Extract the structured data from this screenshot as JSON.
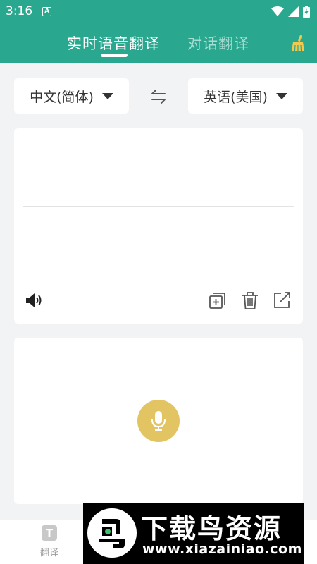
{
  "status_bar": {
    "time": "3:16",
    "notification_badge": "A"
  },
  "header": {
    "tabs": [
      {
        "label": "实时语音翻译",
        "active": true
      },
      {
        "label": "对话翻译",
        "active": false
      }
    ],
    "clear_icon": "broom-icon",
    "accent_color": "#2aa88f",
    "clear_icon_color": "#f2c94c"
  },
  "languages": {
    "source": "中文(简体)",
    "target": "英语(美国)",
    "swap_icon": "swap-arrows-icon"
  },
  "text_card": {
    "source_text": "",
    "translated_text": "",
    "actions": [
      "speaker-icon",
      "copy-add-icon",
      "trash-icon",
      "share-icon"
    ]
  },
  "voice_card": {
    "mic_icon": "microphone-icon",
    "mic_color": "#e3c462"
  },
  "bottom_nav": {
    "items": [
      {
        "label": "翻译",
        "icon_glyph": "T"
      }
    ]
  },
  "watermark": {
    "title": "下载鸟资源",
    "url": "www.xiazainiao.com"
  }
}
